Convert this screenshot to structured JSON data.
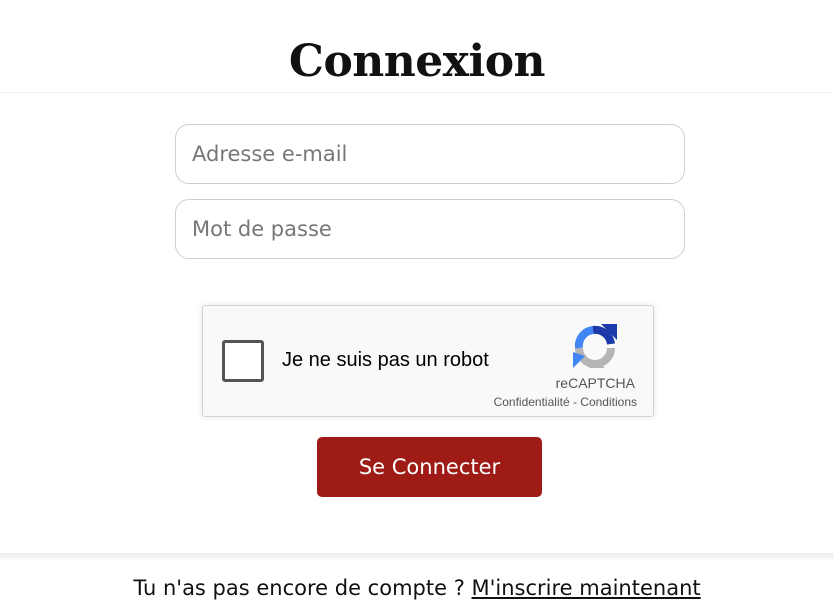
{
  "page": {
    "title": "Connexion"
  },
  "form": {
    "email_placeholder": "Adresse e-mail",
    "password_placeholder": "Mot de passe",
    "submit_label": "Se Connecter"
  },
  "recaptcha": {
    "label": "Je ne suis pas un robot",
    "brand": "reCAPTCHA",
    "privacy_link": "Confidentialité",
    "separator": " - ",
    "terms_link": "Conditions",
    "checked": false,
    "logo_icon": "recaptcha-logo-icon"
  },
  "footer": {
    "prompt": "Tu n'as pas encore de compte ? ",
    "signup_link": "M'inscrire maintenant"
  },
  "colors": {
    "accent": "#9e1b16",
    "recaptcha_blue": "#4285f4",
    "recaptcha_dark_blue": "#1c3aa9",
    "recaptcha_gray": "#b5b5b5"
  }
}
